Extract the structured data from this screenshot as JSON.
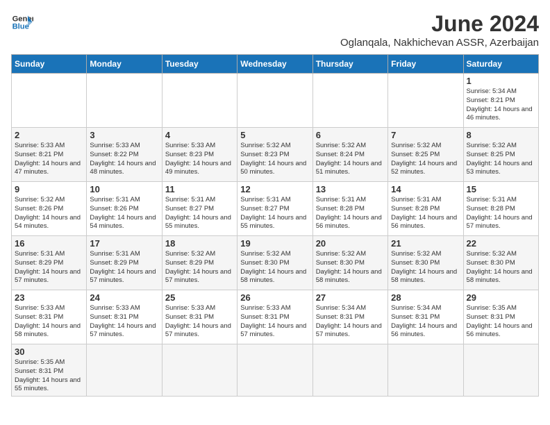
{
  "logo": {
    "line1": "General",
    "line2": "Blue"
  },
  "title": "June 2024",
  "subtitle": "Oglanqala, Nakhichevan ASSR, Azerbaijan",
  "weekdays": [
    "Sunday",
    "Monday",
    "Tuesday",
    "Wednesday",
    "Thursday",
    "Friday",
    "Saturday"
  ],
  "weeks": [
    [
      {
        "day": "",
        "info": ""
      },
      {
        "day": "",
        "info": ""
      },
      {
        "day": "",
        "info": ""
      },
      {
        "day": "",
        "info": ""
      },
      {
        "day": "",
        "info": ""
      },
      {
        "day": "",
        "info": ""
      },
      {
        "day": "1",
        "info": "Sunrise: 5:34 AM\nSunset: 8:21 PM\nDaylight: 14 hours and 46 minutes."
      }
    ],
    [
      {
        "day": "2",
        "info": "Sunrise: 5:33 AM\nSunset: 8:21 PM\nDaylight: 14 hours and 47 minutes."
      },
      {
        "day": "3",
        "info": "Sunrise: 5:33 AM\nSunset: 8:22 PM\nDaylight: 14 hours and 48 minutes."
      },
      {
        "day": "4",
        "info": "Sunrise: 5:33 AM\nSunset: 8:23 PM\nDaylight: 14 hours and 49 minutes."
      },
      {
        "day": "5",
        "info": "Sunrise: 5:32 AM\nSunset: 8:23 PM\nDaylight: 14 hours and 50 minutes."
      },
      {
        "day": "6",
        "info": "Sunrise: 5:32 AM\nSunset: 8:24 PM\nDaylight: 14 hours and 51 minutes."
      },
      {
        "day": "7",
        "info": "Sunrise: 5:32 AM\nSunset: 8:25 PM\nDaylight: 14 hours and 52 minutes."
      },
      {
        "day": "8",
        "info": "Sunrise: 5:32 AM\nSunset: 8:25 PM\nDaylight: 14 hours and 53 minutes."
      }
    ],
    [
      {
        "day": "9",
        "info": "Sunrise: 5:32 AM\nSunset: 8:26 PM\nDaylight: 14 hours and 54 minutes."
      },
      {
        "day": "10",
        "info": "Sunrise: 5:31 AM\nSunset: 8:26 PM\nDaylight: 14 hours and 54 minutes."
      },
      {
        "day": "11",
        "info": "Sunrise: 5:31 AM\nSunset: 8:27 PM\nDaylight: 14 hours and 55 minutes."
      },
      {
        "day": "12",
        "info": "Sunrise: 5:31 AM\nSunset: 8:27 PM\nDaylight: 14 hours and 55 minutes."
      },
      {
        "day": "13",
        "info": "Sunrise: 5:31 AM\nSunset: 8:28 PM\nDaylight: 14 hours and 56 minutes."
      },
      {
        "day": "14",
        "info": "Sunrise: 5:31 AM\nSunset: 8:28 PM\nDaylight: 14 hours and 56 minutes."
      },
      {
        "day": "15",
        "info": "Sunrise: 5:31 AM\nSunset: 8:28 PM\nDaylight: 14 hours and 57 minutes."
      }
    ],
    [
      {
        "day": "16",
        "info": "Sunrise: 5:31 AM\nSunset: 8:29 PM\nDaylight: 14 hours and 57 minutes."
      },
      {
        "day": "17",
        "info": "Sunrise: 5:31 AM\nSunset: 8:29 PM\nDaylight: 14 hours and 57 minutes."
      },
      {
        "day": "18",
        "info": "Sunrise: 5:32 AM\nSunset: 8:29 PM\nDaylight: 14 hours and 57 minutes."
      },
      {
        "day": "19",
        "info": "Sunrise: 5:32 AM\nSunset: 8:30 PM\nDaylight: 14 hours and 58 minutes."
      },
      {
        "day": "20",
        "info": "Sunrise: 5:32 AM\nSunset: 8:30 PM\nDaylight: 14 hours and 58 minutes."
      },
      {
        "day": "21",
        "info": "Sunrise: 5:32 AM\nSunset: 8:30 PM\nDaylight: 14 hours and 58 minutes."
      },
      {
        "day": "22",
        "info": "Sunrise: 5:32 AM\nSunset: 8:30 PM\nDaylight: 14 hours and 58 minutes."
      }
    ],
    [
      {
        "day": "23",
        "info": "Sunrise: 5:33 AM\nSunset: 8:31 PM\nDaylight: 14 hours and 58 minutes."
      },
      {
        "day": "24",
        "info": "Sunrise: 5:33 AM\nSunset: 8:31 PM\nDaylight: 14 hours and 57 minutes."
      },
      {
        "day": "25",
        "info": "Sunrise: 5:33 AM\nSunset: 8:31 PM\nDaylight: 14 hours and 57 minutes."
      },
      {
        "day": "26",
        "info": "Sunrise: 5:33 AM\nSunset: 8:31 PM\nDaylight: 14 hours and 57 minutes."
      },
      {
        "day": "27",
        "info": "Sunrise: 5:34 AM\nSunset: 8:31 PM\nDaylight: 14 hours and 57 minutes."
      },
      {
        "day": "28",
        "info": "Sunrise: 5:34 AM\nSunset: 8:31 PM\nDaylight: 14 hours and 56 minutes."
      },
      {
        "day": "29",
        "info": "Sunrise: 5:35 AM\nSunset: 8:31 PM\nDaylight: 14 hours and 56 minutes."
      }
    ],
    [
      {
        "day": "30",
        "info": "Sunrise: 5:35 AM\nSunset: 8:31 PM\nDaylight: 14 hours and 55 minutes."
      },
      {
        "day": "",
        "info": ""
      },
      {
        "day": "",
        "info": ""
      },
      {
        "day": "",
        "info": ""
      },
      {
        "day": "",
        "info": ""
      },
      {
        "day": "",
        "info": ""
      },
      {
        "day": "",
        "info": ""
      }
    ]
  ]
}
